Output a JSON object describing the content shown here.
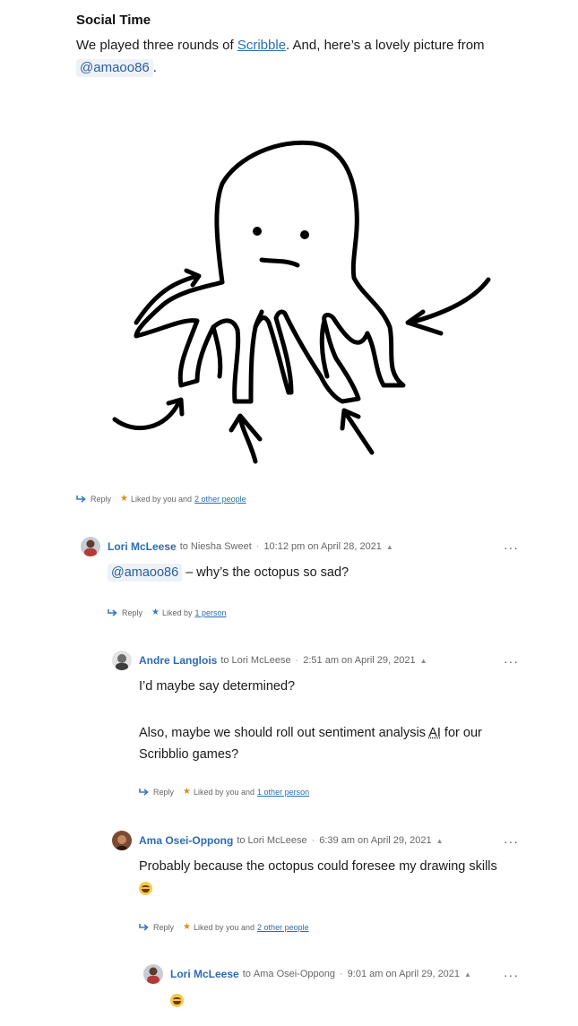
{
  "post": {
    "section_title": "Social Time",
    "intro_prefix": "We played three rounds of ",
    "intro_link": "Scribble",
    "intro_suffix": ". And, here’s a lovely picture from",
    "mention": "@amaoo86",
    "intro_end": "."
  },
  "post_actions": {
    "reply": "Reply",
    "liked_prefix": "Liked by you and",
    "liked_link": "2 other people"
  },
  "comments": [
    {
      "author": "Lori McLeese",
      "to_label": "to",
      "to": "Niesha Sweet",
      "time": "10:12 pm on April 28, 2021",
      "mention": "@amaoo86",
      "text": " – why’s the octopus so sad?",
      "reply": "Reply",
      "liked_prefix": "Liked by",
      "liked_link": "1 person"
    },
    {
      "author": "Andre Langlois",
      "to_label": "to",
      "to": "Lori McLeese",
      "time": "2:51 am on April 29, 2021",
      "line1": "I’d maybe say determined?",
      "line2_prefix": "Also, maybe we should roll out sentiment analysis ",
      "line2_abbr": "AI",
      "line2_suffix": " for our",
      "line3": "Scribblio games?",
      "reply": "Reply",
      "liked_prefix": "Liked by you and",
      "liked_link": "1 other person"
    },
    {
      "author": "Ama Osei-Oppong",
      "to_label": "to",
      "to": "Lori McLeese",
      "time": "6:39 am on April 29, 2021",
      "text": "Probably because the octopus could foresee my drawing skills",
      "reply": "Reply",
      "liked_prefix": "Liked by you and",
      "liked_link": "2 other people"
    },
    {
      "author": "Lori McLeese",
      "to_label": "to",
      "to": "Ama Osei-Oppong",
      "time": "9:01 am on April 29, 2021"
    }
  ],
  "more_label": "···",
  "sep": "·",
  "caret": "▲"
}
